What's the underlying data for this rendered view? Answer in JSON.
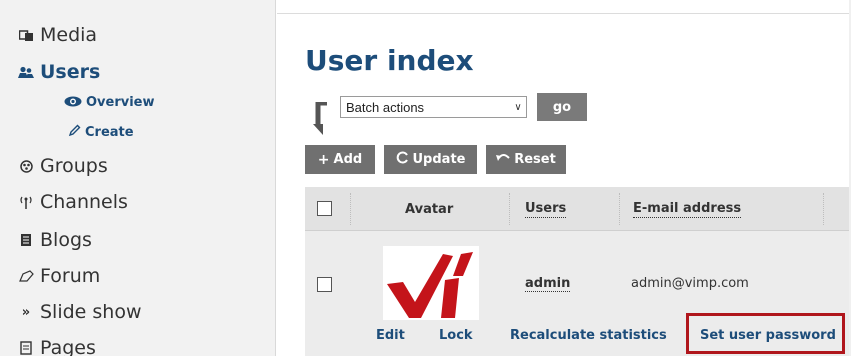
{
  "sidebar": {
    "items": [
      {
        "label": "Media",
        "icon": "media-icon"
      },
      {
        "label": "Users",
        "icon": "users-icon",
        "active": true
      },
      {
        "label": "Groups",
        "icon": "groups-icon"
      },
      {
        "label": "Channels",
        "icon": "channels-icon"
      },
      {
        "label": "Blogs",
        "icon": "blogs-icon"
      },
      {
        "label": "Forum",
        "icon": "forum-icon"
      },
      {
        "label": "Slide show",
        "icon": "slideshow-icon"
      },
      {
        "label": "Pages",
        "icon": "pages-icon"
      }
    ],
    "subitems": [
      {
        "label": "Overview",
        "icon": "eye-icon"
      },
      {
        "label": "Create",
        "icon": "pencil-icon"
      }
    ]
  },
  "main": {
    "title": "User index",
    "batch": {
      "selected": "Batch actions",
      "go_label": "go"
    },
    "toolbar": {
      "add_label": "Add",
      "update_label": "Update",
      "reset_label": "Reset"
    },
    "table": {
      "columns": [
        "Avatar",
        "Users",
        "E-mail address"
      ],
      "rows": [
        {
          "username": "admin",
          "email": "admin@vimp.com",
          "actions": [
            "Edit",
            "Lock",
            "Recalculate statistics",
            "Set user password"
          ]
        }
      ]
    }
  },
  "colors": {
    "accent": "#1d4d7a",
    "highlight": "#b0161c",
    "logo_red": "#c4141a"
  }
}
